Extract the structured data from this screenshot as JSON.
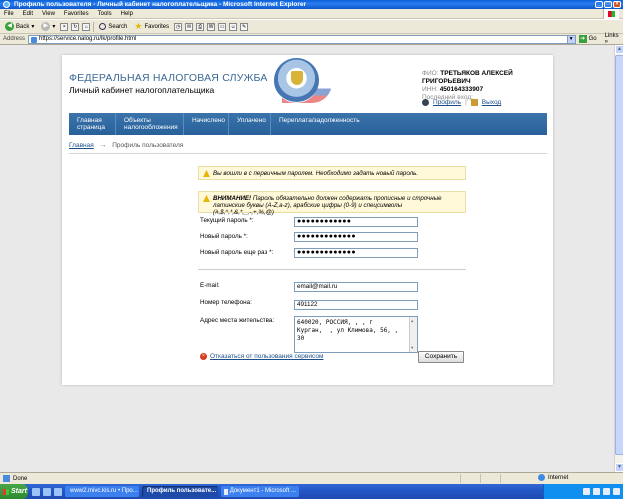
{
  "window": {
    "title": "Профиль пользователя - Личный кабинет налогоплательщика - Microsoft Internet Explorer"
  },
  "menu": [
    "File",
    "Edit",
    "View",
    "Favorites",
    "Tools",
    "Help"
  ],
  "toolbar": {
    "back_label": "Back",
    "search_label": "Search",
    "favorites_label": "Favorites"
  },
  "address": {
    "label": "Address",
    "url": "https://service.nalog.ru/lk/profile.html",
    "go_label": "Go",
    "links_label": "Links"
  },
  "site": {
    "title": "ФЕДЕРАЛЬНАЯ НАЛОГОВАЯ СЛУЖБА",
    "subtitle": "Личный кабинет налогоплательщика"
  },
  "user": {
    "fio_label": "ФИО:",
    "fio": "ТРЕТЬЯКОВ АЛЕКСЕЙ ГРИГОРЬЕВИЧ",
    "inn_label": "ИНН:",
    "inn": "450164333907",
    "last_login_label": "Последний вход:",
    "profile_link": "Профиль",
    "logout_link": "Выход"
  },
  "nav": [
    {
      "label": "Главная страница"
    },
    {
      "label": "Объекты налогообложения"
    },
    {
      "label": "Начислено"
    },
    {
      "label": "Уплачено"
    },
    {
      "label": "Переплата/задолженность"
    }
  ],
  "breadcrumb": {
    "home": "Главная",
    "arrow": "→",
    "current": "Профиль пользователя"
  },
  "notices": {
    "first_login": "Вы вошли в с первичным паролем. Необходимо задать новый пароль.",
    "warning_title": "ВНИМАНИЕ!",
    "warning_text": "Пароль обязательно должен содержать прописные и строчные латинские буквы (A-Z,a-z), арабские цифры (0-9) и спецсимволы (#,$,^,*,&,*,_,-,+,%,@)"
  },
  "form": {
    "current_password_label": "Текущий пароль *:",
    "current_password_value": "●●●●●●●●●●●●",
    "new_password_label": "Новый пароль *:",
    "new_password_value": "●●●●●●●●●●●●●",
    "repeat_password_label": "Новый пароль еще раз *:",
    "repeat_password_value": "●●●●●●●●●●●●●",
    "email_label": "E-mail:",
    "email_value": "email@mail.ru",
    "phone_label": "Номер телефона:",
    "phone_value": "491122",
    "address_label": "Адрес места жительства:",
    "address_value": "640020, РОССИЯ, , , г\nКурган,  , ул Климова, 56, ,\n30",
    "refuse_link": "Отказаться от пользования сервисом",
    "save_button": "Сохранить"
  },
  "status": {
    "text": "Done",
    "zone": "Internet"
  },
  "taskbar": {
    "start": "Start",
    "tasks": [
      "www2.mivc.kis.ru • Про...",
      "Профиль пользовате...",
      "Документ1 - Microsoft ..."
    ]
  }
}
